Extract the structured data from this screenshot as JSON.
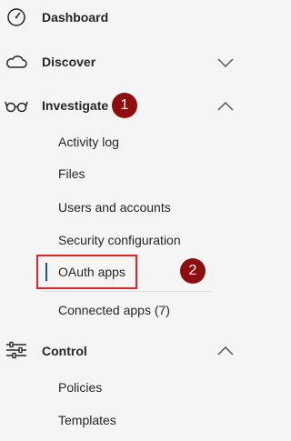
{
  "nav": {
    "sections": [
      {
        "label": "Dashboard",
        "icon": "gauge-icon"
      },
      {
        "label": "Discover",
        "icon": "cloud-icon",
        "chevron": "chevron-down-icon"
      },
      {
        "label": "Investigate",
        "icon": "glasses-icon",
        "chevron": "chevron-up-icon"
      },
      {
        "label": "Control",
        "icon": "sliders-icon",
        "chevron": "chevron-up-icon"
      }
    ],
    "investigate_items": [
      {
        "label": "Activity log"
      },
      {
        "label": "Files"
      },
      {
        "label": "Users and accounts"
      },
      {
        "label": "Security configuration"
      },
      {
        "label": "OAuth apps",
        "selected": true
      },
      {
        "label": "Connected apps (7)"
      }
    ],
    "control_items": [
      {
        "label": "Policies"
      },
      {
        "label": "Templates"
      }
    ]
  },
  "annotations": {
    "badge_1": "1",
    "badge_2": "2",
    "badge_color": "#8e0d0d",
    "highlight_color": "#e02424"
  }
}
